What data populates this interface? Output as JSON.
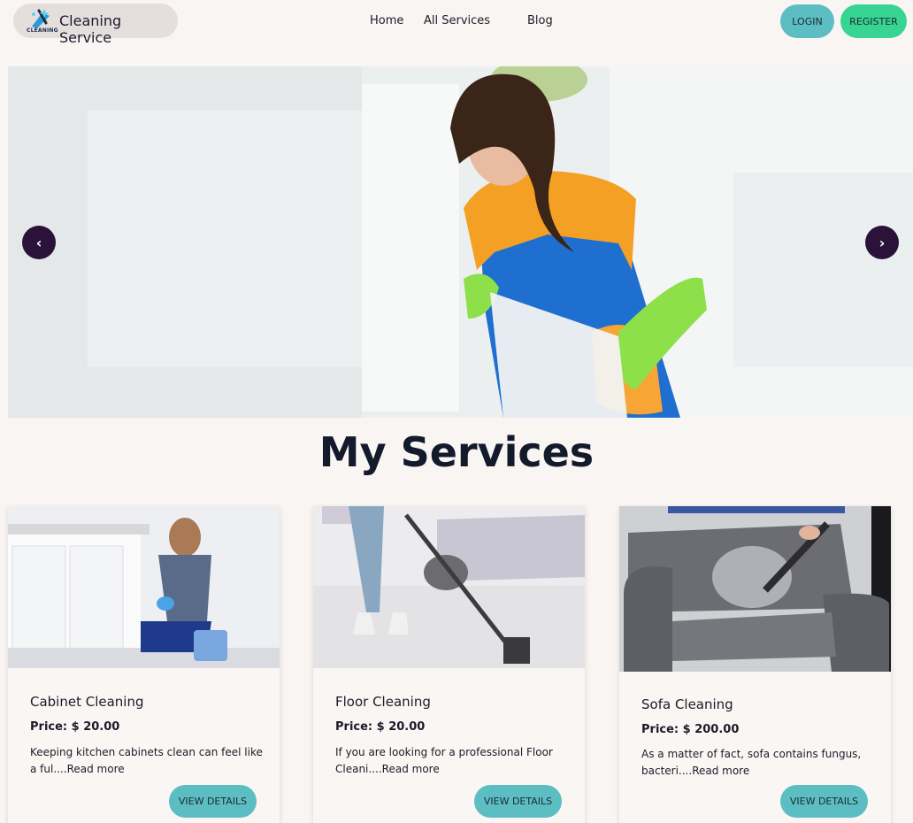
{
  "navbar": {
    "brand_name": "Cleaning Service",
    "logo_text": "CLEANING",
    "links": [
      "Home",
      "All Services",
      "Blog"
    ],
    "login_label": "LOGIN",
    "register_label": "REGISTER"
  },
  "hero": {
    "prev_label": "‹",
    "next_label": "›"
  },
  "services": {
    "title": "My Services",
    "cards": [
      {
        "name": "Cabinet Cleaning",
        "price": "Price: $ 20.00",
        "desc": "Keeping kitchen cabinets clean can feel like a ful....",
        "read_more": "Read more",
        "button": "VIEW DETAILS"
      },
      {
        "name": "Floor Cleaning",
        "price": "Price: $ 20.00",
        "desc": "If you are looking for a professional Floor Cleani....",
        "read_more": "Read more",
        "button": "VIEW DETAILS"
      },
      {
        "name": "Sofa Cleaning",
        "price": "Price: $ 200.00",
        "desc": "As a matter of fact, sofa contains fungus, bacteri....",
        "read_more": "Read more",
        "button": "VIEW DETAILS"
      }
    ]
  },
  "colors": {
    "page_bg": "#f9f5f2",
    "login_bg": "#5cbec3",
    "register_bg": "#37d493",
    "arrow_bg": "#2a1238",
    "title_color": "#121a2c"
  }
}
